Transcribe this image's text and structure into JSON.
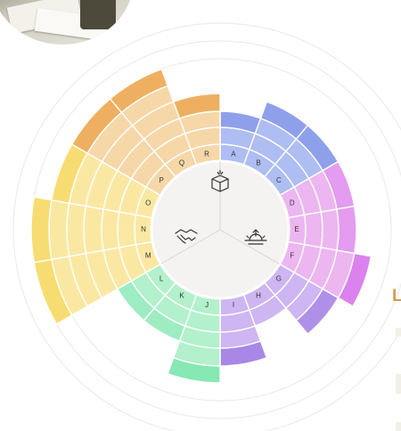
{
  "colors": {
    "red": "#ffffff",
    "purple": "#dc82ee",
    "green": "#86e8b2",
    "orange": "#eeb060",
    "yellow": "#f7dd71",
    "ring_guide": "#ececec"
  },
  "center": {
    "icons": [
      {
        "name": "gift-box-icon"
      },
      {
        "name": "sunrise-icon"
      },
      {
        "name": "handshake-icon"
      }
    ]
  },
  "segments": [
    {
      "letter": "A",
      "value": 3,
      "color": "#aebdf2",
      "outer": "#8fa0ea"
    },
    {
      "letter": "B",
      "value": 4,
      "color": "#aebdf2",
      "outer": "#8fa0ea"
    },
    {
      "letter": "C",
      "value": 4,
      "color": "#aebdf2",
      "outer": "#8fa0ea"
    },
    {
      "letter": "D",
      "value": 4,
      "color": "#ecb6f1",
      "outer": "#e39cef"
    },
    {
      "letter": "E",
      "value": 4,
      "color": "#ecb6f1",
      "outer": "#e39cef"
    },
    {
      "letter": "F",
      "value": 5,
      "color": "#ecb6f1",
      "outer": "#dc82ee"
    },
    {
      "letter": "G",
      "value": 4,
      "color": "#cdb6f1",
      "outer": "#b08fe8"
    },
    {
      "letter": "H",
      "value": 2,
      "color": "#cdb6f1",
      "outer": "#b08fe8"
    },
    {
      "letter": "I",
      "value": 4,
      "color": "#cdb6f1",
      "outer": "#a887e6"
    },
    {
      "letter": "J",
      "value": 5,
      "color": "#b3f0cc",
      "outer": "#86e8b2"
    },
    {
      "letter": "K",
      "value": 3,
      "color": "#b3f0cc",
      "outer": "#9eecc2"
    },
    {
      "letter": "L",
      "value": 3,
      "color": "#b3f0cc",
      "outer": "#9eecc2"
    },
    {
      "letter": "M",
      "value": 7,
      "color": "#fae8a2",
      "outer": "#f7dd71"
    },
    {
      "letter": "N",
      "value": 7,
      "color": "#fae8a2",
      "outer": "#f7dd71"
    },
    {
      "letter": "O",
      "value": 6,
      "color": "#fae8a2",
      "outer": "#f7dd71"
    },
    {
      "letter": "P",
      "value": 6,
      "color": "#f6d7a8",
      "outer": "#eeb060"
    },
    {
      "letter": "Q",
      "value": 6,
      "color": "#f6d7a8",
      "outer": "#eeb060"
    },
    {
      "letter": "R",
      "value": 4,
      "color": "#f6d7a8",
      "outer": "#eeb060"
    }
  ],
  "side_text": "L"
}
